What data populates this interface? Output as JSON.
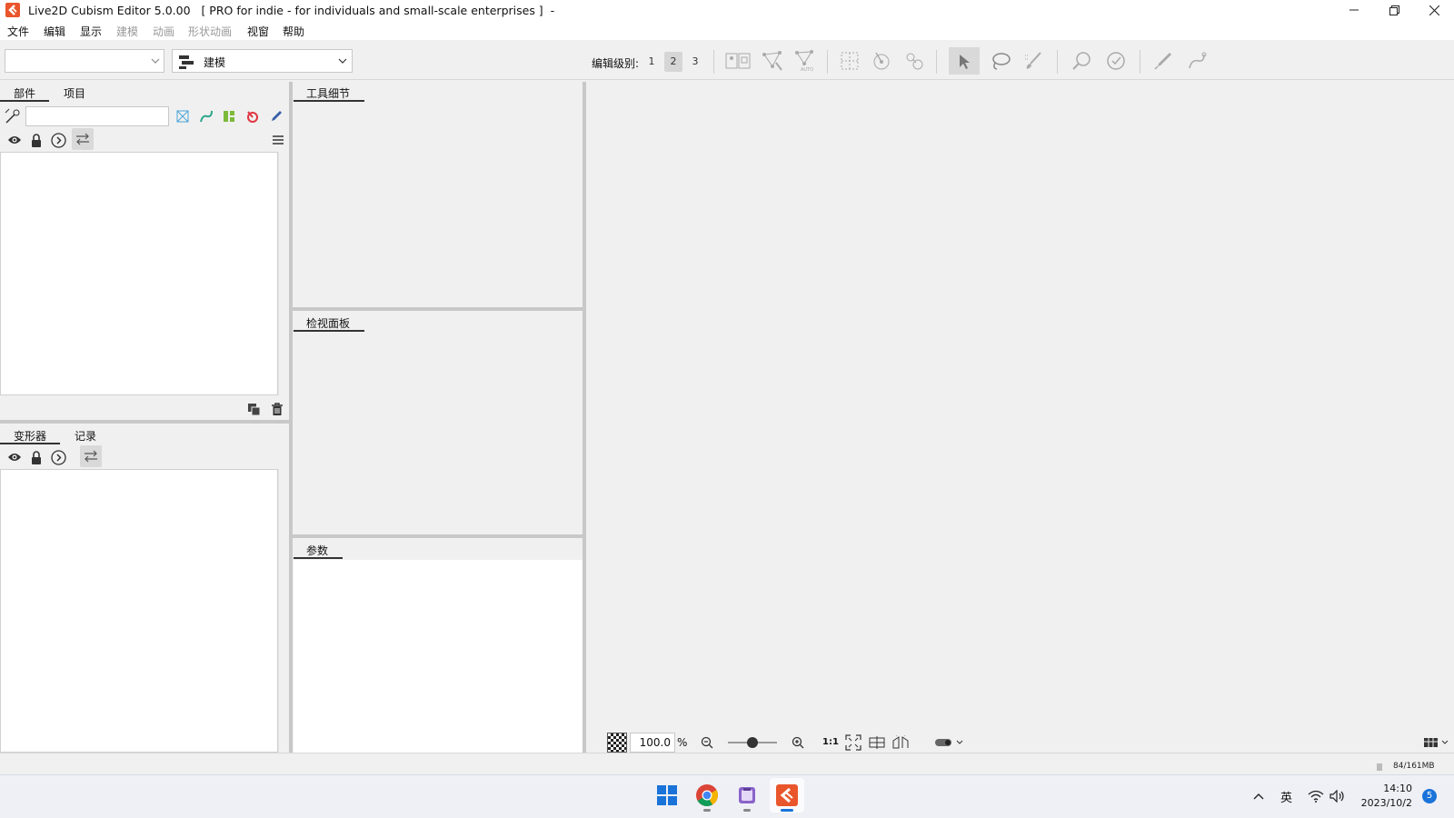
{
  "window": {
    "title": "Live2D Cubism Editor 5.0.00   [ PRO for indie - for individuals and small-scale enterprises ]  -",
    "minimize_label": "—",
    "maximize_label": "❐",
    "close_label": "✕"
  },
  "menu": {
    "items": [
      "文件",
      "编辑",
      "显示",
      "建模",
      "动画",
      "形状动画",
      "视窗",
      "帮助"
    ]
  },
  "toolbar": {
    "workspace_value": "",
    "mode_value": "建模",
    "edit_level_label": "编辑级别:",
    "edit_levels": [
      "1",
      "2",
      "3"
    ],
    "selected_level": "2",
    "auto_label": "AUTO"
  },
  "parts_panel": {
    "tabs": [
      "部件",
      "项目"
    ],
    "search_value": ""
  },
  "deformer_panel": {
    "tabs": [
      "变形器",
      "记录"
    ]
  },
  "tool_details_panel": {
    "title": "工具细节"
  },
  "inspector_panel": {
    "title": "检视面板"
  },
  "parameters_panel": {
    "title": "参数"
  },
  "viewport": {
    "zoom_value": "100.0",
    "zoom_unit": "%",
    "one_to_one_label": "1:1",
    "zoom_slider_position": 0.5
  },
  "status": {
    "memory": "84/161MB"
  },
  "taskbar": {
    "ime_label": "英",
    "time": "14:10",
    "date": "2023/10/2",
    "notification_count": "5"
  },
  "colors": {
    "brand": "#e9562b",
    "panel_bg": "#f0f0f0",
    "taskbar_bg": "#eef0f6",
    "selected_level_bg": "#d6d6d6",
    "active_tool_bg": "#d9d9d9"
  }
}
